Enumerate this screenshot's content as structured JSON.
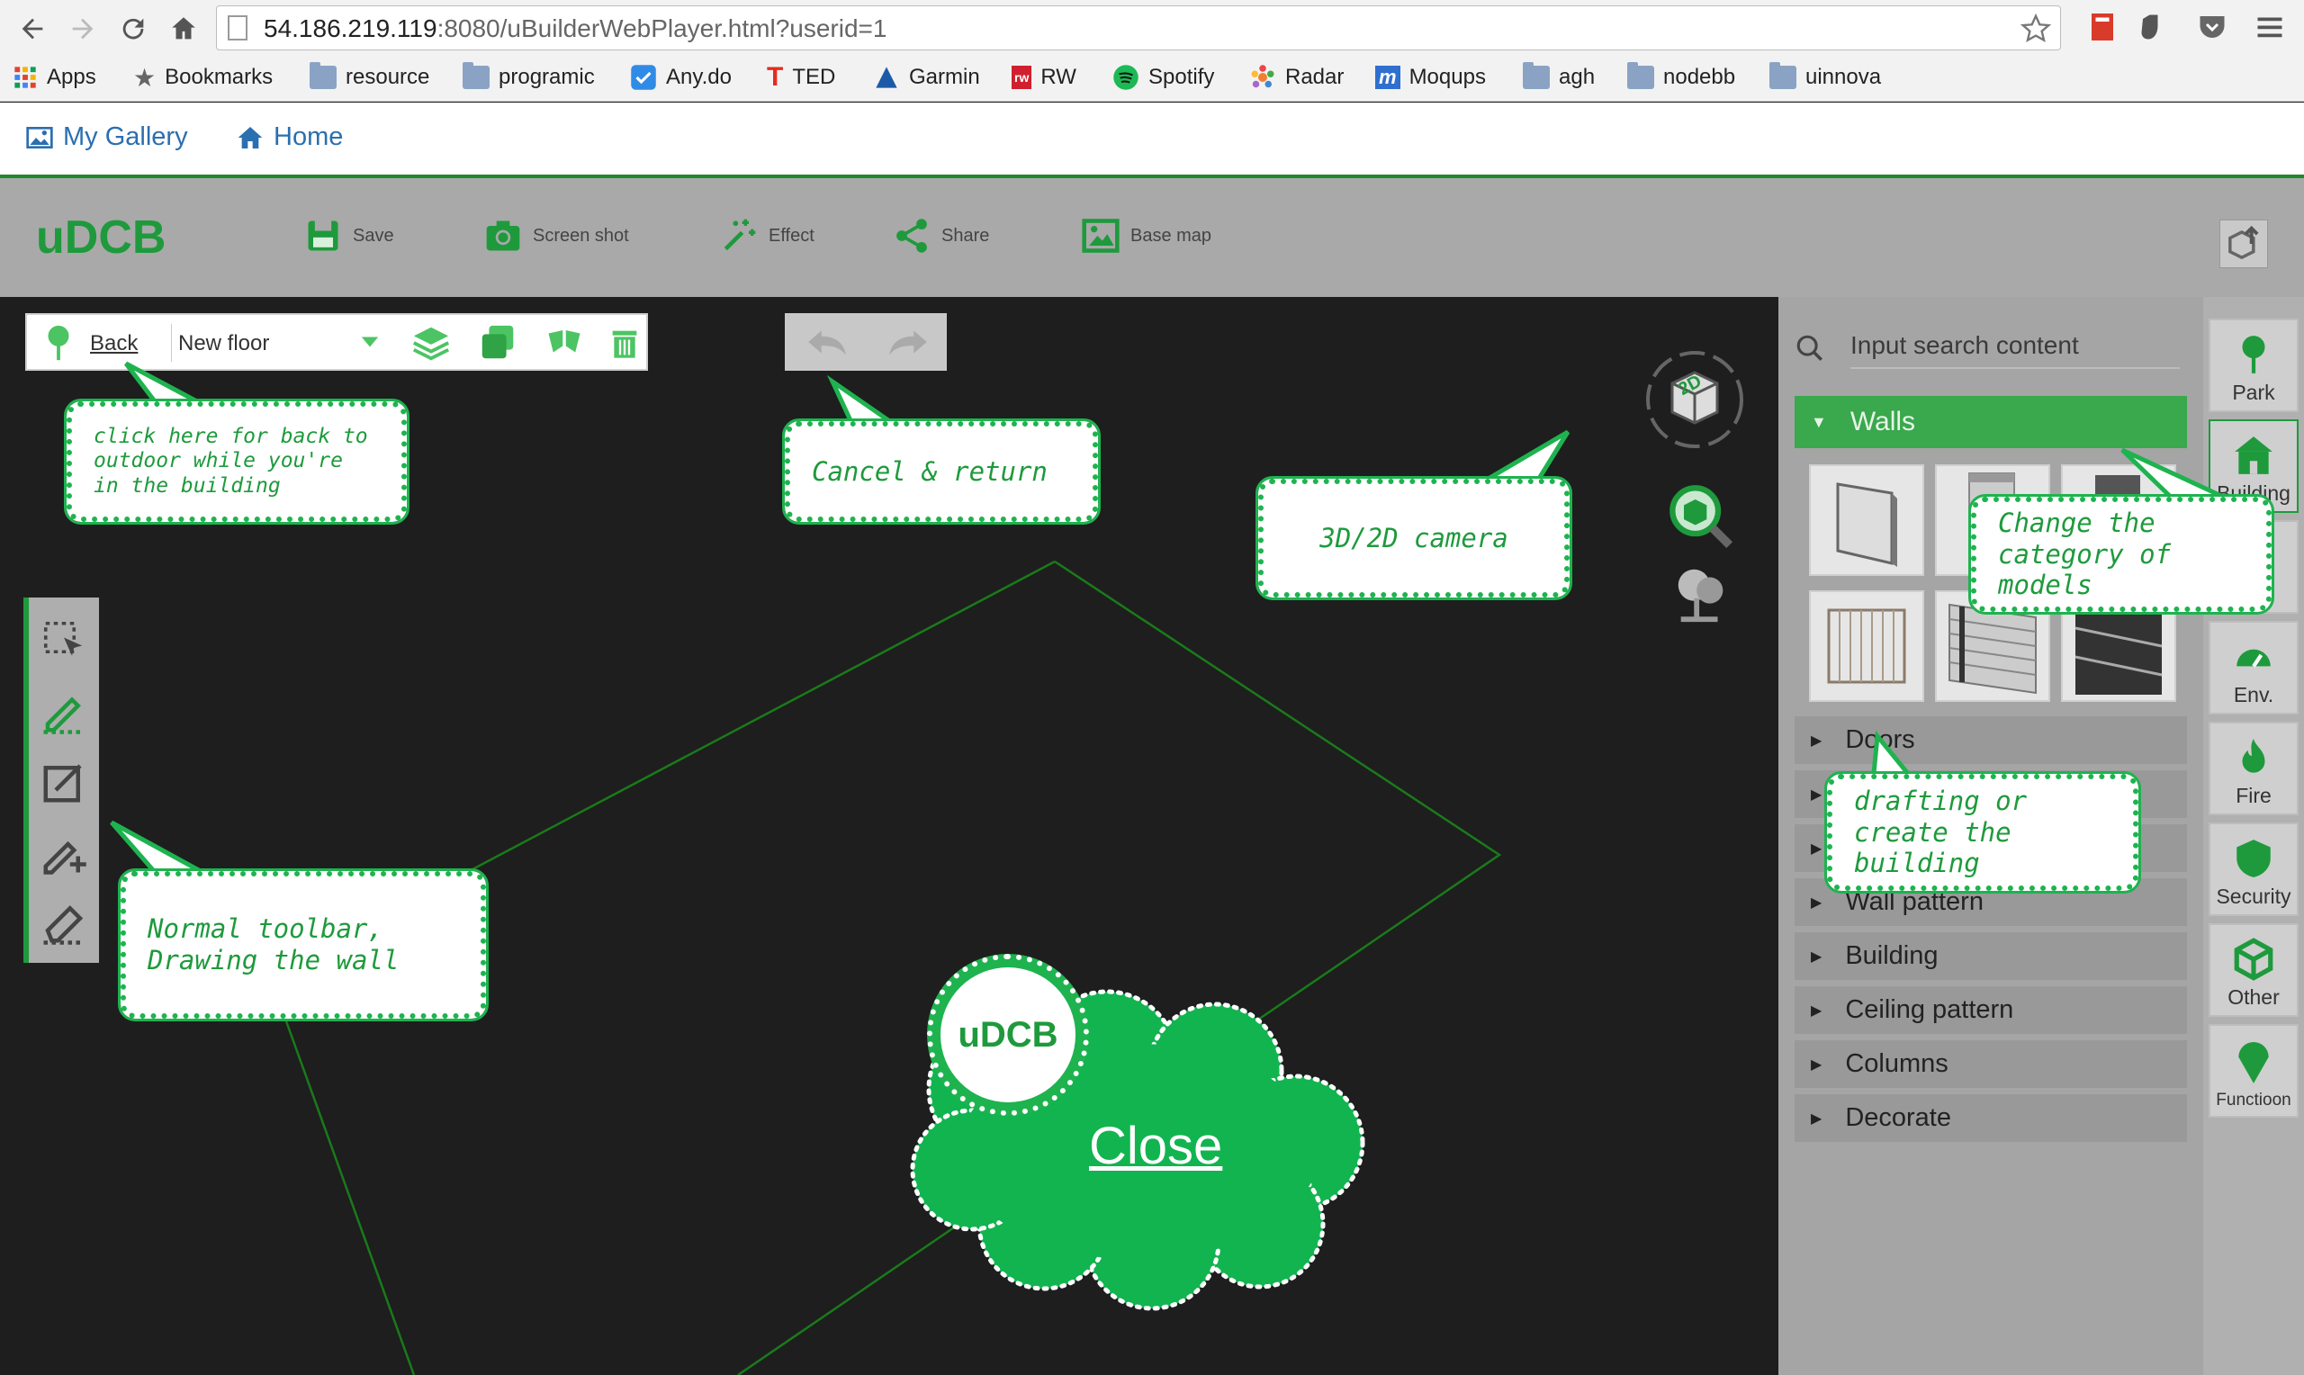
{
  "browser": {
    "url_host": "54.186.219.119",
    "url_rest": ":8080/uBuilderWebPlayer.html?userid=1",
    "bookmarks": [
      "Apps",
      "Bookmarks",
      "resource",
      "programic",
      "Any.do",
      "TED",
      "Garmin",
      "RW",
      "Spotify",
      "Radar",
      "Moqups",
      "agh",
      "nodebb",
      "uinnova"
    ]
  },
  "topnav": {
    "gallery": "My Gallery",
    "home": "Home"
  },
  "app": {
    "logo": "uDCB",
    "toolbar": {
      "save": "Save",
      "screenshot": "Screen shot",
      "effect": "Effect",
      "share": "Share",
      "basemap": "Base map"
    },
    "floorbar": {
      "back": "Back",
      "floor": "New floor"
    }
  },
  "panel": {
    "search_placeholder": "Input search content",
    "active_category": "Walls",
    "categories": [
      "Doors",
      "",
      "",
      "Wall pattern",
      "Building",
      "Ceiling pattern",
      "Columns",
      "Decorate"
    ]
  },
  "rail": [
    "Park",
    "Building",
    "",
    "Env.",
    "Fire",
    "Security",
    "Other",
    "Functioon"
  ],
  "callouts": {
    "back": "click here for back to outdoor while you're in the building",
    "cancel": "Cancel & return",
    "camera": "3D/2D camera",
    "category": "Change the category of models",
    "drafting": "drafting or create the building",
    "toolbar": "Normal toolbar, Drawing the wall"
  },
  "overlay": {
    "badge": "uDCB",
    "close": "Close"
  },
  "colors": {
    "accent": "#1eb34f",
    "brand": "#1e9a3c",
    "link": "#2a6fb0"
  }
}
